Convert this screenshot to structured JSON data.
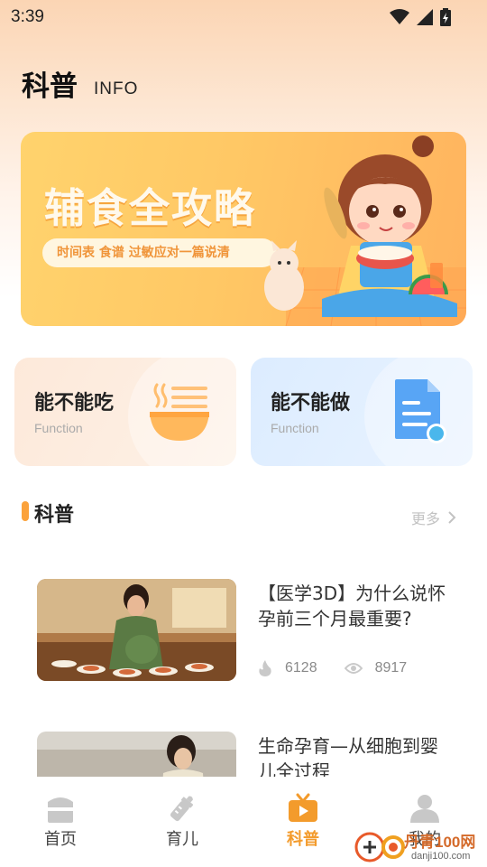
{
  "status_bar": {
    "time": "3:39",
    "icons": [
      "wifi-icon",
      "signal-icon",
      "battery-charging-icon"
    ]
  },
  "header": {
    "title": "科普",
    "subtitle": "INFO"
  },
  "banner": {
    "title": "辅食全攻略",
    "tagline": "时间表 食谱 过敏应对一篇说清"
  },
  "cards": [
    {
      "title": "能不能吃",
      "subtitle": "Function",
      "icon": "noodle-bowl-icon"
    },
    {
      "title": "能不能做",
      "subtitle": "Function",
      "icon": "document-icon"
    }
  ],
  "section": {
    "title": "科普",
    "more_label": "更多"
  },
  "articles": [
    {
      "title": "【医学3D】为什么说怀孕前三个月最重要?",
      "likes": "6128",
      "views": "8917"
    },
    {
      "title": "生命孕育—从细胞到婴儿全过程"
    }
  ],
  "tabs": [
    {
      "label": "首页",
      "icon": "home-icon"
    },
    {
      "label": "育儿",
      "icon": "baby-bottle-icon"
    },
    {
      "label": "科普",
      "icon": "tv-icon",
      "active": true
    },
    {
      "label": "我的",
      "icon": "user-icon"
    }
  ],
  "watermark": {
    "text": "丹青100网",
    "domain": "danji100.com"
  },
  "colors": {
    "accent": "#f39b2c",
    "banner": "#ffc865",
    "card_food": "#fde9da",
    "card_do": "#dcecff"
  }
}
